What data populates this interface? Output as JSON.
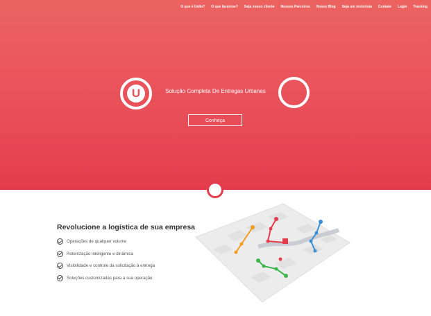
{
  "nav": {
    "items": [
      "O que é Uello?",
      "O que fazemos?",
      "Seja nosso cliente",
      "Nossos Parceiros",
      "Nosso Blog",
      "Seja um motorista",
      "Contato",
      "Login",
      "Tracking"
    ]
  },
  "hero": {
    "logo_letter": "U",
    "tagline": "Solução Completa De Entregas Urbanas",
    "cta_label": "Conheça"
  },
  "features": {
    "title": "Revolucione a logística de sua empresa",
    "items": [
      "Operações de qualquer volume",
      "Roteirização inteligente e dinâmica",
      "Visibilidade e controle da solicitação à entrega",
      "Soluções customizadas para a sua operação"
    ]
  },
  "colors": {
    "brand_red": "#e9505a",
    "route_orange": "#f39c20",
    "route_red": "#e43c4c",
    "route_green": "#3cb54a",
    "route_blue": "#3a8fd8"
  }
}
